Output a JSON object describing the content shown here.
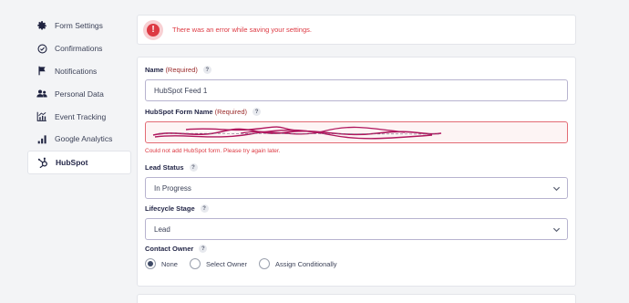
{
  "sidebar": {
    "items": [
      {
        "label": "Form Settings",
        "icon": "gear-icon",
        "active": false
      },
      {
        "label": "Confirmations",
        "icon": "check-circle-icon",
        "active": false
      },
      {
        "label": "Notifications",
        "icon": "flag-icon",
        "active": false
      },
      {
        "label": "Personal Data",
        "icon": "users-icon",
        "active": false
      },
      {
        "label": "Event Tracking",
        "icon": "event-chart-icon",
        "active": false
      },
      {
        "label": "Google Analytics",
        "icon": "bar-chart-icon",
        "active": false
      },
      {
        "label": "HubSpot",
        "icon": "hubspot-icon",
        "active": true
      }
    ]
  },
  "alert": {
    "icon": "!",
    "message": "There was an error while saving your settings."
  },
  "form": {
    "name": {
      "label": "Name",
      "required": "(Required)",
      "help": "?",
      "value": "HubSpot Feed 1"
    },
    "hubspot_form": {
      "label": "HubSpot Form Name",
      "required": "(Required)",
      "help": "?",
      "error": "Could not add HubSpot form. Please try again later."
    },
    "lead_status": {
      "label": "Lead Status",
      "help": "?",
      "value": "In Progress"
    },
    "lifecycle_stage": {
      "label": "Lifecycle Stage",
      "help": "?",
      "value": "Lead"
    },
    "contact_owner": {
      "label": "Contact Owner",
      "help": "?",
      "options": [
        "None",
        "Select Owner",
        "Assign Conditionally"
      ],
      "selected": "None"
    }
  },
  "colors": {
    "error": "#dd3a43",
    "scribble": "#b0175e",
    "required": "#9b2b2b",
    "field_border": "#b7b3cf"
  }
}
